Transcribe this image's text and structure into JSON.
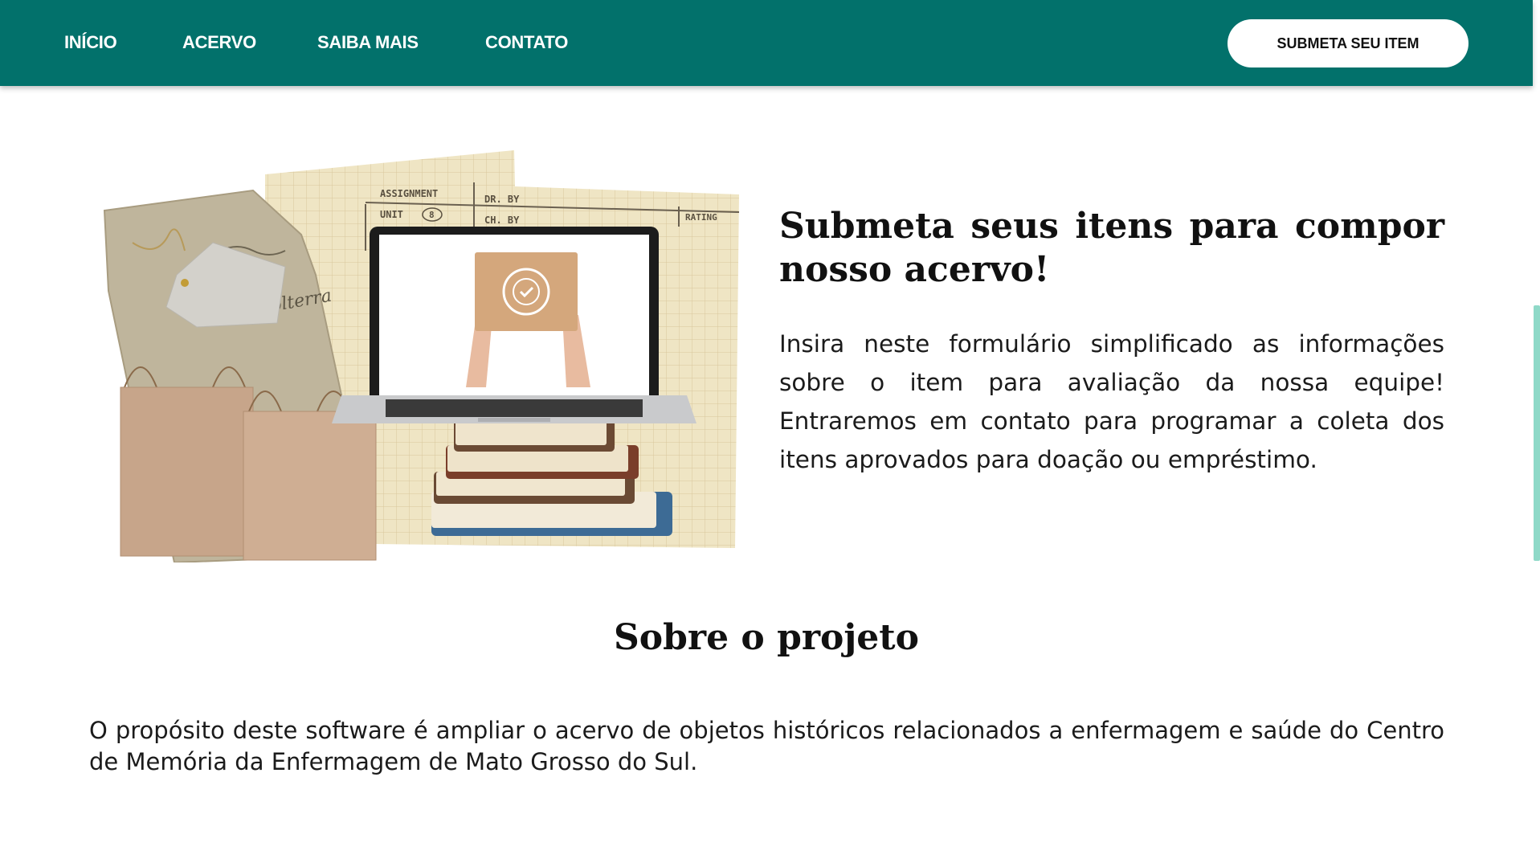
{
  "nav": {
    "items": [
      {
        "label": "INÍCIO"
      },
      {
        "label": "ACERVO"
      },
      {
        "label": "SAIBA MAIS"
      },
      {
        "label": "CONTATO"
      }
    ],
    "cta_label": "SUBMETA SEU ITEM",
    "bg_color": "#02716b"
  },
  "hero": {
    "title": "Submeta seus itens para compor nosso acervo!",
    "text": "Insira neste formulário simplificado as informações sobre o item para avaliação da nossa equipe! Entraremos em contato para programar a coleta dos itens aprovados para doação ou empréstimo.",
    "collage": {
      "paper_labels": [
        "ASSIGNMENT",
        "UNIT",
        "8",
        "DR. BY",
        "CH. BY",
        "RATING"
      ],
      "handwriting": "Volterra"
    }
  },
  "about": {
    "title": "Sobre o projeto",
    "text": "O propósito deste software é ampliar o acervo de objetos históricos relacionados a enfermagem e saúde do Centro de Memória da Enfermagem de Mato Grosso do Sul."
  }
}
